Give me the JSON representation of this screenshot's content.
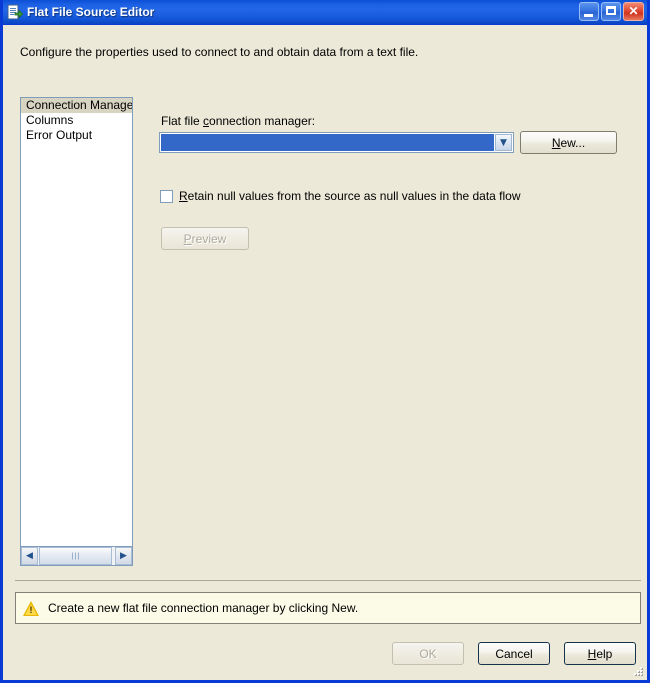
{
  "window": {
    "title": "Flat File Source Editor",
    "icon": "flat-file-source-icon",
    "buttons": {
      "minimize": "minimize-icon",
      "maximize": "maximize-icon",
      "close": "✕"
    }
  },
  "description": "Configure the properties used to connect to and obtain data from a text file.",
  "pages": [
    {
      "label": "Connection Manager",
      "selected": true
    },
    {
      "label": "Columns",
      "selected": false
    },
    {
      "label": "Error Output",
      "selected": false
    }
  ],
  "scrollbar": {
    "left_arrow": "◀",
    "right_arrow": "▶"
  },
  "connection": {
    "label_prefix": "Flat file ",
    "label_accel": "c",
    "label_suffix": "onnection manager:",
    "value": "",
    "dropdown_arrow": "▼",
    "new_button": {
      "accel": "N",
      "rest": "ew..."
    }
  },
  "retain_nulls": {
    "checked": false,
    "accel": "R",
    "rest": "etain null values from the source as null values in the data flow"
  },
  "preview_button": {
    "accel": "P",
    "rest": "review",
    "enabled": false
  },
  "warning": {
    "icon": "warning-triangle-icon",
    "glyph": "!",
    "text": "Create a new flat file connection manager by clicking New."
  },
  "footer_buttons": {
    "ok": {
      "label": "OK",
      "enabled": false
    },
    "cancel": {
      "label": "Cancel",
      "enabled": true
    },
    "help": {
      "accel": "H",
      "rest": "elp",
      "enabled": true
    }
  },
  "colors": {
    "dialog_background": "#ece9d8",
    "title_blue": "#0a51d6",
    "selection_blue": "#3468c8",
    "warning_background": "#fbfbe8",
    "border_blue": "#0a3ad6"
  }
}
